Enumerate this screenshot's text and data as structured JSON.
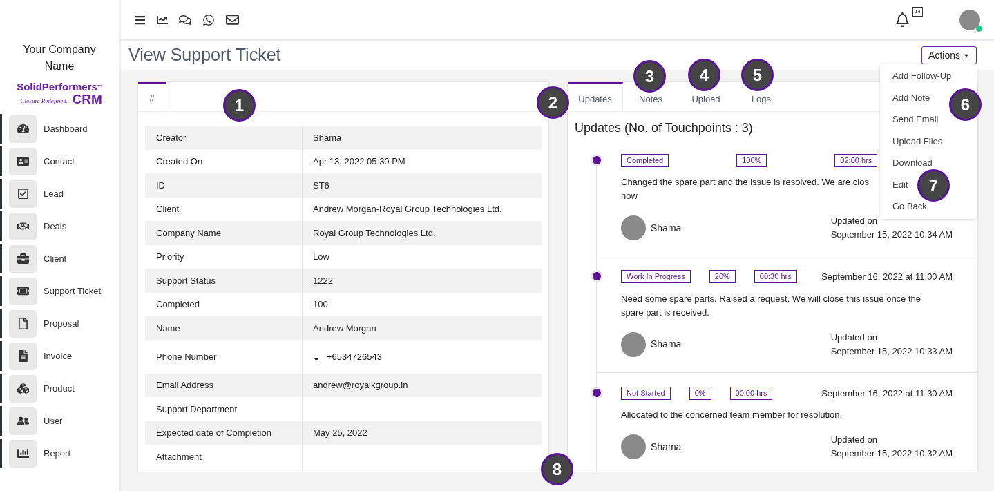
{
  "sidebar": {
    "company": "Your Company Name",
    "logo": {
      "name": "SolidPerformers",
      "mark": "™",
      "tagline": "Closure Redefined...",
      "product": "CRM"
    },
    "items": [
      {
        "label": "Dashboard",
        "selected": false
      },
      {
        "label": "Contact",
        "selected": false
      },
      {
        "label": "Lead",
        "selected": false
      },
      {
        "label": "Deals",
        "selected": false
      },
      {
        "label": "Client",
        "selected": false
      },
      {
        "label": "Support Ticket",
        "selected": false
      },
      {
        "label": "Proposal",
        "selected": false
      },
      {
        "label": "Invoice",
        "selected": false
      },
      {
        "label": "Product",
        "selected": false
      },
      {
        "label": "User",
        "selected": false
      },
      {
        "label": "Report",
        "selected": false
      }
    ]
  },
  "topbar": {
    "notifications": "14",
    "online": true
  },
  "page_title": "View Support Ticket",
  "actions": {
    "label": "Actions",
    "expanded": true,
    "items": [
      "Add Follow-Up",
      "Add Note",
      "Send Email",
      "Upload Files",
      "Download",
      "Edit",
      "Go Back"
    ]
  },
  "details": {
    "tabs": [
      {
        "label": "#",
        "selected": true
      }
    ],
    "rows": [
      {
        "label": "Creator",
        "value": "Shama"
      },
      {
        "label": "Created On",
        "value": "Apr 13, 2022 05:30 PM"
      },
      {
        "label": "ID",
        "value": "ST6"
      },
      {
        "label": "Client",
        "value": "Andrew Morgan-Royal Group Technologies Ltd."
      },
      {
        "label": "Company Name",
        "value": "Royal Group Technologies Ltd."
      },
      {
        "label": "Priority",
        "value": "Low"
      },
      {
        "label": "Support Status",
        "value": "1222"
      },
      {
        "label": "Completed",
        "value": "100"
      },
      {
        "label": "Name",
        "value": "Andrew Morgan"
      },
      {
        "label": "Phone Number",
        "value": "+6534726543",
        "kind": "phone"
      },
      {
        "label": "Email Address",
        "value": "andrew@royalkgroup.in"
      },
      {
        "label": "Support Department"
      },
      {
        "label": "Expected date of Completion",
        "value": "May 25, 2022"
      },
      {
        "label": "Attachment"
      }
    ]
  },
  "updates": {
    "tabs": [
      {
        "label": "Updates",
        "selected": true
      },
      {
        "label": "Notes",
        "selected": false
      },
      {
        "label": "Upload",
        "selected": false
      },
      {
        "label": "Logs",
        "selected": false
      }
    ],
    "heading": "Updates (No. of Touchpoints : 3)",
    "items": [
      {
        "status": "Completed",
        "percent": "100%",
        "hours": "02:00 hrs",
        "text": [
          "Changed the spare part and the issue is resolved. We are clos",
          "now"
        ],
        "author": "Shama",
        "updated_label": "Updated on",
        "updated_at": "September 15, 2022 10:34 AM"
      },
      {
        "status": "Work In Progress",
        "percent": "20%",
        "hours": "00:30 hrs",
        "date": "September 16, 2022 at 11:00 AM",
        "text": [
          "Need some spare parts. Raised a request. We will close this issue once the",
          "spare part is received."
        ],
        "author": "Shama",
        "updated_label": "Updated on",
        "updated_at": "September 15, 2022 10:33 AM"
      },
      {
        "status": "Not Started",
        "percent": "0%",
        "hours": "00:00 hrs",
        "date": "September 16, 2022 at 11:30 AM",
        "text": [
          "Allocated to the concerned team member for resolution."
        ],
        "author": "Shama",
        "updated_label": "Updated on",
        "updated_at": "September 15, 2022 10:32 AM"
      }
    ]
  },
  "callouts": [
    "1",
    "2",
    "3",
    "4",
    "5",
    "6",
    "7",
    "8"
  ]
}
